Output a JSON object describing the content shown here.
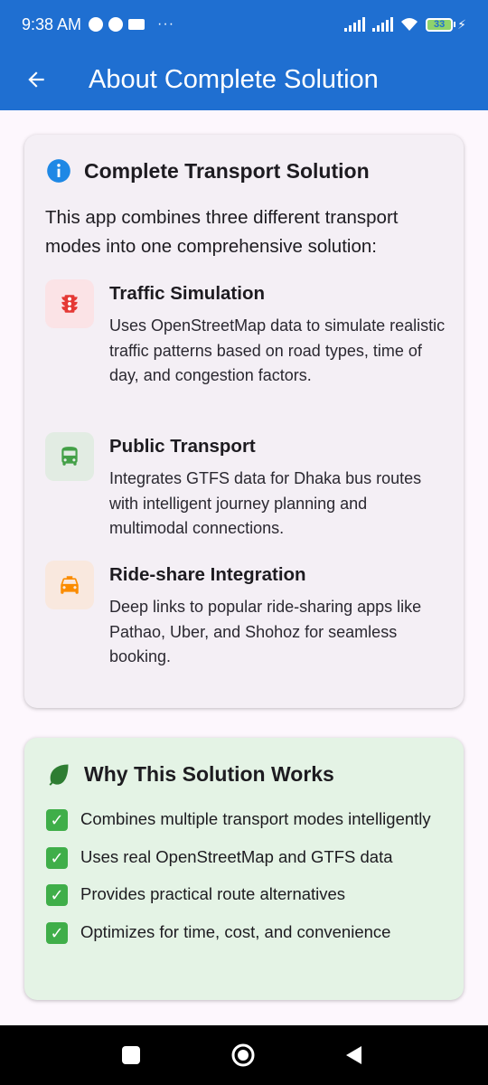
{
  "status": {
    "time": "9:38 AM",
    "battery": "33"
  },
  "app_bar": {
    "title": "About Complete Solution",
    "color": "#1f6fd1"
  },
  "solution_card": {
    "title": "Complete Transport Solution",
    "intro": "This app combines three different transport modes into one comprehensive solution:",
    "features": [
      {
        "icon": "traffic-light-icon",
        "title": "Traffic Simulation",
        "description": "Uses OpenStreetMap data to simulate realistic traffic patterns based on road types, time of day, and congestion factors.",
        "color": "#e53935"
      },
      {
        "icon": "bus-icon",
        "title": "Public Transport",
        "description": "Integrates GTFS data for Dhaka bus routes with intelligent journey planning and multimodal connections.",
        "color": "#43a047"
      },
      {
        "icon": "taxi-icon",
        "title": "Ride-share Integration",
        "description": "Deep links to popular ride-sharing apps like Pathao, Uber, and Shohoz for seamless booking.",
        "color": "#fb8c00"
      }
    ]
  },
  "why_card": {
    "title": "Why This Solution Works",
    "items": [
      "Combines multiple transport modes intelligently",
      "Uses real OpenStreetMap and GTFS data",
      "Provides practical route alternatives",
      "Optimizes for time, cost, and convenience"
    ]
  }
}
